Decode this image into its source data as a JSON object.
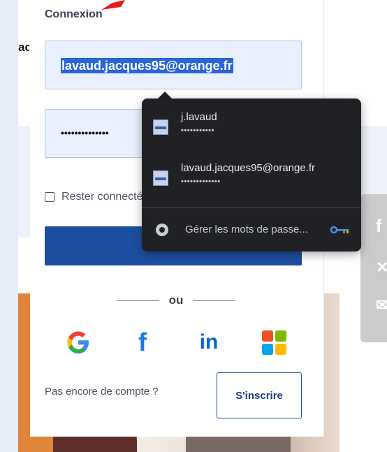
{
  "page": {
    "cut_text": "ac"
  },
  "login": {
    "title": "Connexion",
    "email_value": "lavaud.jacques95@orange.fr",
    "password_masked": "••••••••••••••",
    "remember_label": "Rester connecté",
    "divider_text": "ou",
    "no_account_text": "Pas encore de compte ?",
    "signup_label": "S'inscrire",
    "social": {
      "google": "G",
      "facebook": "f",
      "linkedin": "in"
    }
  },
  "autofill_popup": {
    "credentials": [
      {
        "username": "j.lavaud",
        "password_masked": "•••••••••••"
      },
      {
        "username": "lavaud.jacques95@orange.fr",
        "password_masked": "•••••••••••••"
      }
    ],
    "manage_label": "Gérer les mots de passe..."
  },
  "colors": {
    "primary": "#1d4fa0",
    "popup_bg": "#202124",
    "autofill_bg": "#e8f0fe"
  }
}
